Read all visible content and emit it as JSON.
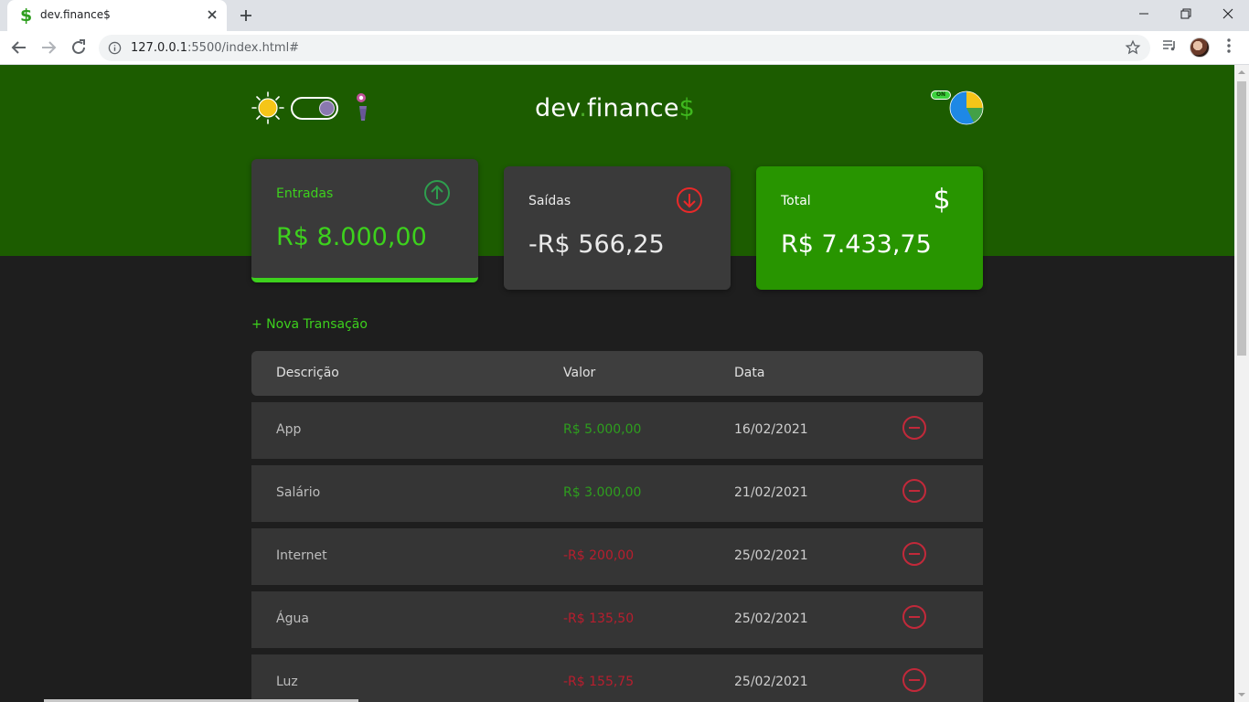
{
  "browser": {
    "tab_title": "dev.finance$",
    "tab_favicon": "$",
    "url_host": "127.0.0.1",
    "url_rest": ":5500/index.html#"
  },
  "header": {
    "logo_main": "dev",
    "logo_dot": ".",
    "logo_word": "finance",
    "logo_dollar": "$",
    "chart_toggle_badge": "ON"
  },
  "cards": {
    "income": {
      "label": "Entradas",
      "value": "R$ 8.000,00"
    },
    "expense": {
      "label": "Saídas",
      "value": "-R$ 566,25"
    },
    "total": {
      "label": "Total",
      "value": "R$ 7.433,75",
      "icon": "$"
    }
  },
  "new_transaction": "+ Nova Transação",
  "table": {
    "headers": {
      "description": "Descrição",
      "amount": "Valor",
      "date": "Data"
    },
    "rows": [
      {
        "description": "App",
        "amount": "R$ 5.000,00",
        "date": "16/02/2021",
        "type": "income"
      },
      {
        "description": "Salário",
        "amount": "R$ 3.000,00",
        "date": "21/02/2021",
        "type": "income"
      },
      {
        "description": "Internet",
        "amount": "-R$ 200,00",
        "date": "25/02/2021",
        "type": "expense"
      },
      {
        "description": "Água",
        "amount": "-R$ 135,50",
        "date": "25/02/2021",
        "type": "expense"
      },
      {
        "description": "Luz",
        "amount": "-R$ 155,75",
        "date": "25/02/2021",
        "type": "expense"
      }
    ]
  },
  "colors": {
    "hero": "#1c5c00",
    "income": "#3dd11d",
    "expense": "#e92929",
    "total_card": "#289500"
  }
}
